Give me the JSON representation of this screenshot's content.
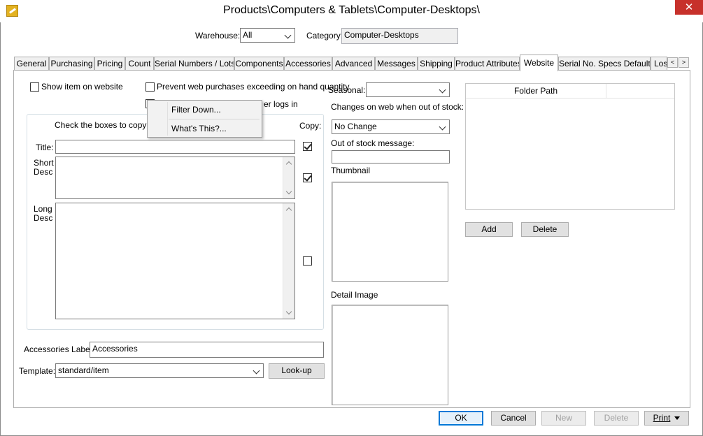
{
  "window": {
    "title": "Products\\Computers & Tablets\\Computer-Desktops\\",
    "close_glyph": "✕"
  },
  "filters": {
    "warehouse_label": "Warehouse:",
    "warehouse_value": "All",
    "category_label": "Category:",
    "category_value": "Computer-Desktops"
  },
  "tabs": [
    "General",
    "Purchasing",
    "Pricing",
    "Count",
    "Serial Numbers / Lots",
    "Components",
    "Accessories",
    "Advanced",
    "Messages",
    "Shipping",
    "Product Attributes",
    "Website",
    "Serial No. Specs Defaults",
    "Los"
  ],
  "active_tab": "Website",
  "tab_scroll": {
    "left": "<",
    "right": ">"
  },
  "website": {
    "show_on_website_label": "Show item on website",
    "prevent_purchases_label": "Prevent web purchases exceeding on hand quantity",
    "logs_in_label_partial": "er logs in",
    "copy_group": {
      "instruction": "Check the boxes to copy lab",
      "copy_label": "Copy:",
      "title_label": "Title:",
      "short_desc_label": "Short\nDesc",
      "long_desc_label": "Long\nDesc",
      "title_checked": true,
      "short_desc_checked": true,
      "long_desc_checked": false
    },
    "accessories_label": "Accessories Label:",
    "accessories_value": "Accessories",
    "template_label": "Template:",
    "template_value": "standard/item",
    "lookup_button": "Look-up",
    "seasonal_label": "Seasonal:",
    "seasonal_value": "",
    "out_of_stock_change_label": "Changes on web when out of stock:",
    "out_of_stock_change_value": "No Change",
    "out_of_stock_message_label": "Out of stock message:",
    "out_of_stock_message_value": "",
    "thumbnail_label": "Thumbnail",
    "detail_image_label": "Detail Image",
    "folder_path_header": "Folder Path",
    "add_button": "Add",
    "delete_button": "Delete"
  },
  "context_menu": {
    "items": [
      "Filter Down...",
      "What's This?..."
    ]
  },
  "footer": {
    "ok": "OK",
    "cancel": "Cancel",
    "new": "New",
    "delete": "Delete",
    "print": "Print"
  }
}
